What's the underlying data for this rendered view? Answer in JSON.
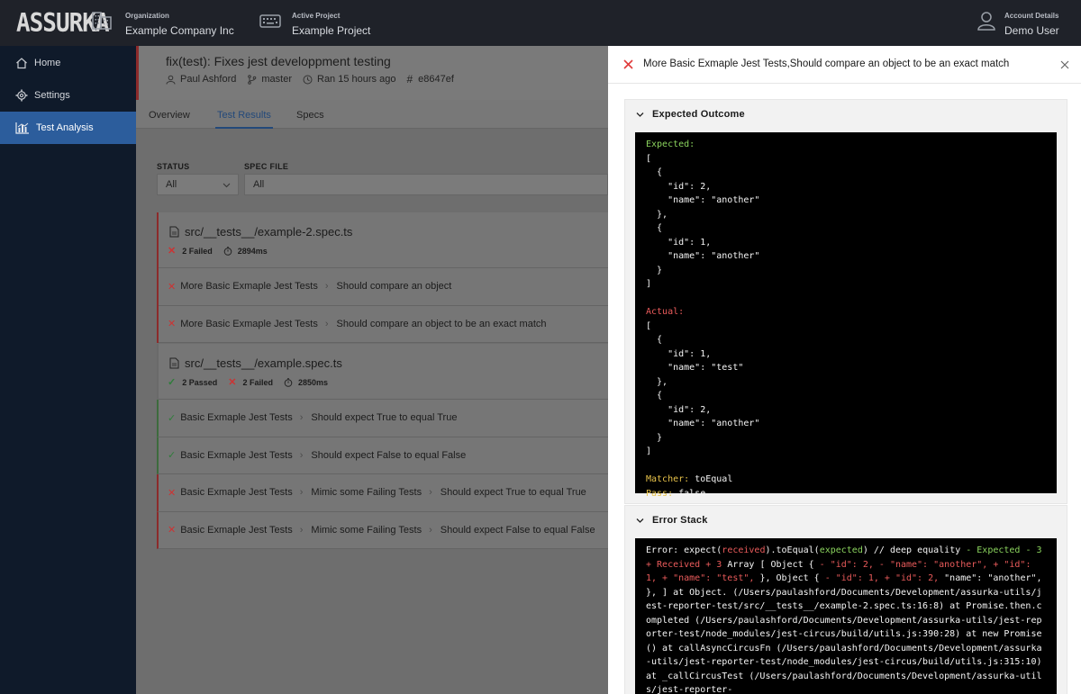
{
  "header": {
    "logo": "ASSURKA",
    "organization_label": "Organization",
    "organization_value": "Example Company Inc",
    "project_label": "Active Project",
    "project_value": "Example Project",
    "account_label": "Account Details",
    "account_value": "Demo User"
  },
  "sidebar": {
    "items": [
      {
        "label": "Home",
        "icon": "home-icon"
      },
      {
        "label": "Settings",
        "icon": "gear-icon"
      },
      {
        "label": "Test Analysis",
        "icon": "chart-icon"
      }
    ],
    "active_index": 2
  },
  "commit": {
    "title": "fix(test): Fixes jest developpment testing",
    "author": "Paul Ashford",
    "branch": "master",
    "ran": "Ran 15 hours ago",
    "hash": "e8647ef"
  },
  "tabs": [
    "Overview",
    "Test Results",
    "Specs"
  ],
  "active_tab": 1,
  "filters": {
    "status_label": "STATUS",
    "status_value": "All",
    "spec_label": "SPEC FILE",
    "spec_value": "All"
  },
  "specs": [
    {
      "name": "src/__tests__/example-2.spec.ts",
      "failed": "2 Failed",
      "duration": "2894ms",
      "tests": [
        {
          "status": "fail",
          "parts": [
            "More Basic Exmaple Jest Tests",
            "Should compare an object"
          ]
        },
        {
          "status": "fail",
          "parts": [
            "More Basic Exmaple Jest Tests",
            "Should compare an object to be an exact match"
          ]
        }
      ]
    },
    {
      "name": "src/__tests__/example.spec.ts",
      "passed": "2 Passed",
      "failed": "2 Failed",
      "duration": "2850ms",
      "tests": [
        {
          "status": "pass",
          "parts": [
            "Basic Exmaple Jest Tests",
            "Should expect True to equal True"
          ]
        },
        {
          "status": "pass",
          "parts": [
            "Basic Exmaple Jest Tests",
            "Should expect False to equal False"
          ]
        },
        {
          "status": "fail",
          "parts": [
            "Basic Exmaple Jest Tests",
            "Mimic some Failing Tests",
            "Should expect True to equal True"
          ]
        },
        {
          "status": "fail",
          "parts": [
            "Basic Exmaple Jest Tests",
            "Mimic some Failing Tests",
            "Should expect False to equal False"
          ]
        }
      ]
    }
  ],
  "panel": {
    "title": "More Basic Exmaple Jest Tests,Should compare an object to be an exact match",
    "expected_section": "Expected Outcome",
    "error_section": "Error Stack",
    "expected_label": "Expected:",
    "expected_body": "[\n  {\n    \"id\": 2,\n    \"name\": \"another\"\n  },\n  {\n    \"id\": 1,\n    \"name\": \"another\"\n  }\n]",
    "actual_label": "Actual:",
    "actual_body": "[\n  {\n    \"id\": 1,\n    \"name\": \"test\"\n  },\n  {\n    \"id\": 2,\n    \"name\": \"another\"\n  }\n]",
    "matcher_label": "Matcher:",
    "matcher_value": "toEqual",
    "pass_label": "Pass:",
    "pass_value": "false",
    "stack": {
      "s1": "Error: expect(",
      "s2": "received",
      "s3": ").toEqual(",
      "s4": "expected",
      "s5": ") // deep equality ",
      "s6": "- Expected - 3 ",
      "s7": "+ Received + 3",
      "s8": " Array [ Object { ",
      "s9": "- \"id\": 2, - \"name\": \"another\", + \"id\": 1, + \"name\": \"test\",",
      "s10": " }, Object { ",
      "s11": "- \"id\": 1, + \"id\": 2,",
      "s12": " \"name\": \"another\", }, ] at Object. (/Users/paulashford/Documents/Development/assurka-utils/jest-reporter-test/src/__tests__/example-2.spec.ts:16:8) at Promise.then.completed (/Users/paulashford/Documents/Development/assurka-utils/jest-reporter-test/node_modules/jest-circus/build/utils.js:390:28) at new Promise () at callAsyncCircusFn (/Users/paulashford/Documents/Development/assurka-utils/jest-reporter-test/node_modules/jest-circus/build/utils.js:315:10) at _callCircusTest (/Users/paulashford/Documents/Development/assurka-utils/jest-reporter-"
    }
  },
  "colors": {
    "topbar": "#1f2229",
    "sidebar": "#0f1a2a",
    "active": "#2c5d9c",
    "fail": "#e03a3a",
    "pass": "#3aa14a"
  }
}
